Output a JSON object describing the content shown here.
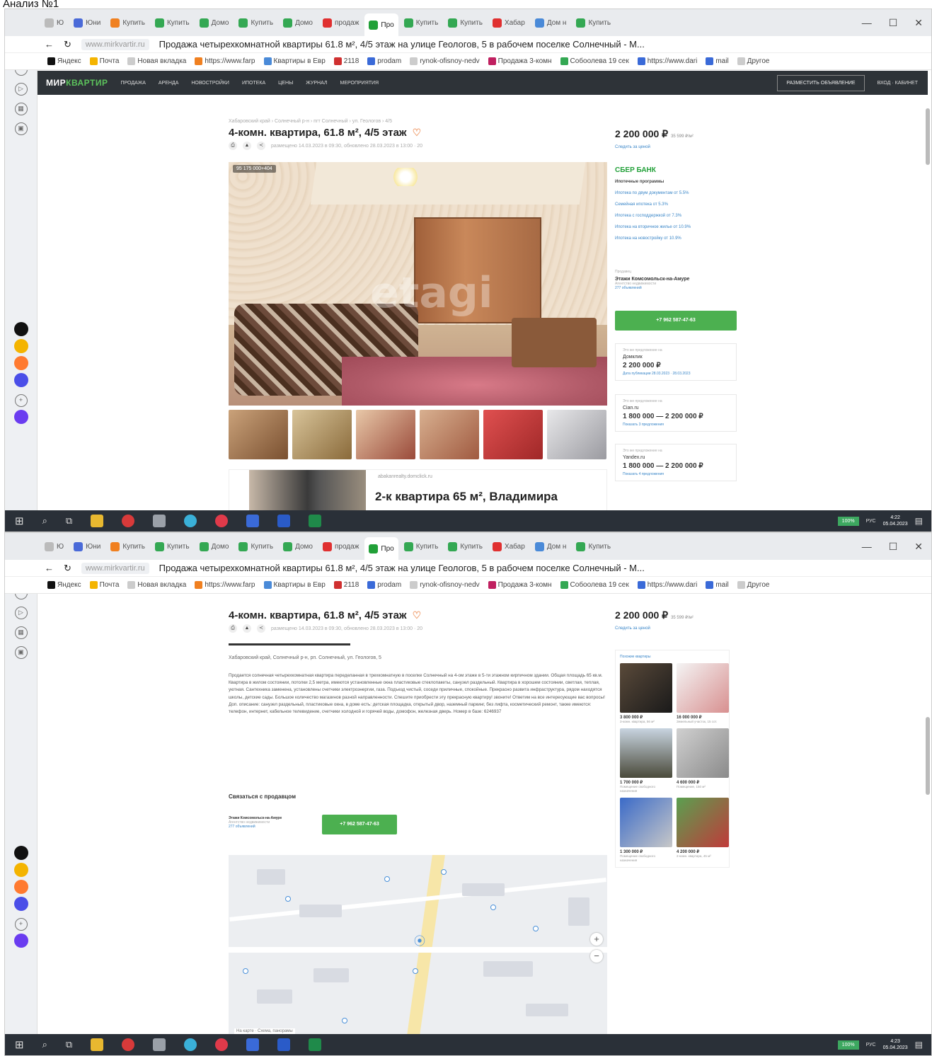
{
  "doc_title": "Анализ №1",
  "screens": [
    {
      "tabs": [
        {
          "label": "Ю"
        },
        {
          "label": "Юни"
        },
        {
          "label": "Купить"
        },
        {
          "label": "Купить"
        },
        {
          "label": "Домо"
        },
        {
          "label": "Купить"
        },
        {
          "label": "Домо"
        },
        {
          "label": "продаж"
        },
        {
          "label": "Про",
          "active": true
        },
        {
          "label": "Купить"
        },
        {
          "label": "Купить"
        },
        {
          "label": "Хабар"
        },
        {
          "label": "Дом н"
        },
        {
          "label": "Купить"
        }
      ]
    },
    {
      "tabs": [
        {
          "label": "Ю"
        },
        {
          "label": "Юни"
        },
        {
          "label": "Купить"
        },
        {
          "label": "Купить"
        },
        {
          "label": "Домо"
        },
        {
          "label": "Купить"
        },
        {
          "label": "Домо"
        },
        {
          "label": "продаж"
        },
        {
          "label": "Про",
          "active": true
        },
        {
          "label": "Купить"
        },
        {
          "label": "Купить"
        },
        {
          "label": "Хабар"
        },
        {
          "label": "Дом н"
        },
        {
          "label": "Купить"
        }
      ]
    }
  ],
  "browser": {
    "url": "www.mirkvartir.ru",
    "page_title": "Продажа четырехкомнатной квартиры 61.8 м², 4/5 этаж на улице Геологов, 5 в рабочем поселке Солнечный - М...",
    "bookmarks": [
      "Яндекс",
      "Почта",
      "Новая вкладка",
      "https://www.farp",
      "Квартиры в Евр",
      "2118",
      "prodam",
      "rynok-ofisnoy-nedv",
      "Продажа 3-комн",
      "Собоолева 19 сек",
      "https://www.dari",
      "mail",
      "Другое"
    ]
  },
  "site": {
    "logo_a": "МИР",
    "logo_b": "КВАРТИР",
    "nav": [
      "ПРОДАЖА",
      "АРЕНДА",
      "НОВОСТРОЙКИ",
      "ИПОТЕКА",
      "ЦЕНЫ",
      "ЖУРНАЛ",
      "МЕРОПРИЯТИЯ"
    ],
    "post_btn": "РАЗМЕСТИТЬ ОБЪЯВЛЕНИЕ",
    "login": "ВХОД · КАБИНЕТ"
  },
  "listing": {
    "breadcrumbs": "Хабаровский край › Солнечный р-н › пгт Солнечный › ул. Геологов › 4/5",
    "title": "4-комн. квартира, 61.8 м², 4/5 этаж",
    "meta": "размещено 14.03.2023 в 09:30, обновлено 28.03.2023 в 13:00 · 20",
    "photo_tag": "95 175 000+404",
    "watermark": "etagi",
    "price": "2 200 000 ₽",
    "price_per_m": "35 599 ₽/м²",
    "price_link": "Следить за ценой",
    "address": "Хабаровский край, Солнечный р-н, рп. Солнечный, ул. Геологов, 5",
    "description": "Продается солнечная четырехкомнатная квартира переделанная в трехкомнатную в поселке Солнечный на 4-ом этаже в 5-ти этажном кирпичном здании. Общая площадь 65 кв.м. Квартира в жилом состоянии, потолки 2,5 метра, имеются установленные окна пластиковые стеклопакеты, санузел раздельный. Квартира в хорошем состоянии, светлая, теплая, уютная. Сантехника заменена, установлены счетчики электроэнергии, газа. Подъезд чистый, соседи приличные, спокойные. Прекрасно развита инфраструктура, рядом находятся школы, детские сады. Большое количество магазинов разной направленности. Спешите приобрести эту прекрасную квартиру! звоните! Ответим на все интересующие вас вопросы! Доп. описание: санузел раздельный, пластиковые окна, в доме есть: детская площадка, открытый двор, наземный паркинг, без лифта, косметический ремонт, также имеются: телефон, интернет, кабельное телевидение, счетчики холодной и горячей воды, домофон, железная дверь. Номер в базе: 6246937",
    "contact_header": "Связаться с продавцом",
    "phone": "+7 962 587-47-63"
  },
  "sber": {
    "brand": "СБЕР БАНК",
    "subtitle": "Ипотечные программы",
    "links": [
      "Ипотека по двум документам от 5.5%",
      "Семейная ипотека от 5.3%",
      "Ипотека с господдержкой от 7.3%",
      "Ипотека на вторичное жилье от 10.9%",
      "Ипотека на новостройку от 10.9%"
    ]
  },
  "agent": {
    "label": "Продавец",
    "name": "Этажи Комсомольск-на-Амуре",
    "sub": "Агентство недвижимости",
    "sub2": "277 объявлений"
  },
  "history": [
    {
      "site": "Домклик",
      "value": "2 200 000 ₽",
      "date": "Дата публикации 28.03.2023 · 28.03.2023"
    },
    {
      "site": "Cian.ru",
      "value": "1 800 000 — 2 200 000 ₽",
      "date": "Показать 3 предложения"
    },
    {
      "site": "Yandex.ru",
      "value": "1 800 000 — 2 200 000 ₽",
      "date": "Показать 4 предложения"
    }
  ],
  "history_label": "Это же предложение на",
  "ad": {
    "source": "abakanrealty.domclick.ru",
    "headline": "2-к квартира 65 м², Владимира"
  },
  "similar": {
    "header": "Похожие квартиры",
    "items": [
      {
        "price": "3 800 000 ₽",
        "desc": "3-комн. квартира, 56 м²"
      },
      {
        "price": "16 000 000 ₽",
        "desc": "Земельный участок, 15 сот."
      },
      {
        "price": "1 700 000 ₽",
        "desc": "Помещение свободного назначения"
      },
      {
        "price": "4 600 000 ₽",
        "desc": "Помещение, 150 м²"
      },
      {
        "price": "1 300 000 ₽",
        "desc": "Помещение свободного назначения"
      },
      {
        "price": "4 200 000 ₽",
        "desc": "2-комн. квартира, 45 м²"
      }
    ]
  },
  "map": {
    "caption": "На карте · Схема, панорамы"
  },
  "taskbar": {
    "battery": "100%",
    "lang": "РУС",
    "time1": "4:22",
    "date1": "05.04.2023",
    "time2": "4:23",
    "date2": "05.04.2023"
  },
  "colors": {
    "accent_green": "#4cb050",
    "site_nav": "#2e3338",
    "sber": "#21a038",
    "link": "#3a86c8"
  }
}
